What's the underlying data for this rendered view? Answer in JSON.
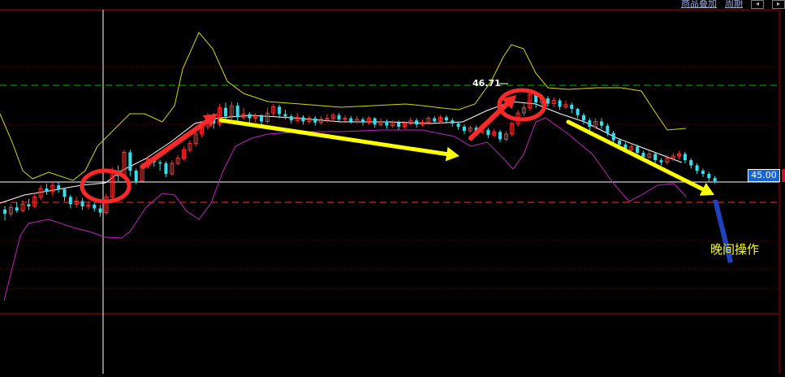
{
  "toolbar": {
    "overlay_label": "商品叠加",
    "period_label": "周期"
  },
  "price_tag": "45.00",
  "peak_label": "46.71",
  "annotation_text": "晚间操作",
  "colors": {
    "bg": "#000000",
    "frame": "#b00000",
    "up": "#ff3232",
    "down": "#34e0f0",
    "upper_band": "#d8d800",
    "lower_band": "#c020c0",
    "mid_band": "#ffffff",
    "green_dashed": "#00c000",
    "red_dashed": "#ff3030",
    "circle": "#ff2828",
    "arrow_yellow": "#ffff00",
    "arrow_blue": "#2040c0"
  },
  "chart_data": {
    "type": "candlestick",
    "y_reference": {
      "current_price": 45.0,
      "high_marker": 46.71
    },
    "overlays": [
      "bollinger-upper",
      "bollinger-mid",
      "bollinger-lower"
    ],
    "annotations": [
      "circle-1",
      "circle-2",
      "arrow-up-1",
      "arrow-down-1",
      "arrow-up-2",
      "arrow-down-2"
    ],
    "candles": [
      {
        "o": 44.46,
        "c": 44.38,
        "h": 44.52,
        "l": 44.25
      },
      {
        "o": 44.38,
        "c": 44.5,
        "h": 44.56,
        "l": 44.32
      },
      {
        "o": 44.5,
        "c": 44.44,
        "h": 44.6,
        "l": 44.4
      },
      {
        "o": 44.44,
        "c": 44.56,
        "h": 44.64,
        "l": 44.4
      },
      {
        "o": 44.56,
        "c": 44.52,
        "h": 44.66,
        "l": 44.45
      },
      {
        "o": 44.52,
        "c": 44.7,
        "h": 44.78,
        "l": 44.48
      },
      {
        "o": 44.7,
        "c": 44.86,
        "h": 44.92,
        "l": 44.64
      },
      {
        "o": 44.86,
        "c": 44.8,
        "h": 44.95,
        "l": 44.74
      },
      {
        "o": 44.8,
        "c": 44.92,
        "h": 45.0,
        "l": 44.72
      },
      {
        "o": 44.92,
        "c": 44.85,
        "h": 44.98,
        "l": 44.78
      },
      {
        "o": 44.85,
        "c": 44.7,
        "h": 44.88,
        "l": 44.62
      },
      {
        "o": 44.7,
        "c": 44.56,
        "h": 44.74,
        "l": 44.48
      },
      {
        "o": 44.56,
        "c": 44.62,
        "h": 44.7,
        "l": 44.5
      },
      {
        "o": 44.62,
        "c": 44.52,
        "h": 44.68,
        "l": 44.45
      },
      {
        "o": 44.52,
        "c": 44.55,
        "h": 44.62,
        "l": 44.46
      },
      {
        "o": 44.55,
        "c": 44.48,
        "h": 44.6,
        "l": 44.42
      },
      {
        "o": 44.48,
        "c": 44.4,
        "h": 44.55,
        "l": 44.32
      },
      {
        "o": 44.4,
        "c": 44.7,
        "h": 44.76,
        "l": 44.36
      },
      {
        "o": 44.7,
        "c": 45.2,
        "h": 45.26,
        "l": 44.66
      },
      {
        "o": 45.2,
        "c": 45.1,
        "h": 45.3,
        "l": 45.0
      },
      {
        "o": 45.1,
        "c": 45.55,
        "h": 45.6,
        "l": 45.05
      },
      {
        "o": 45.55,
        "c": 45.2,
        "h": 45.6,
        "l": 45.1
      },
      {
        "o": 45.2,
        "c": 45.0,
        "h": 45.24,
        "l": 44.94
      },
      {
        "o": 45.0,
        "c": 45.3,
        "h": 45.35,
        "l": 44.98
      },
      {
        "o": 45.3,
        "c": 45.42,
        "h": 45.5,
        "l": 45.24
      },
      {
        "o": 45.42,
        "c": 45.36,
        "h": 45.48,
        "l": 45.28
      },
      {
        "o": 45.36,
        "c": 45.34,
        "h": 45.4,
        "l": 45.2
      },
      {
        "o": 45.34,
        "c": 45.14,
        "h": 45.38,
        "l": 45.08
      },
      {
        "o": 45.14,
        "c": 45.34,
        "h": 45.4,
        "l": 45.1
      },
      {
        "o": 45.34,
        "c": 45.44,
        "h": 45.5,
        "l": 45.3
      },
      {
        "o": 45.44,
        "c": 45.6,
        "h": 45.66,
        "l": 45.4
      },
      {
        "o": 45.6,
        "c": 45.72,
        "h": 45.78,
        "l": 45.55
      },
      {
        "o": 45.72,
        "c": 45.9,
        "h": 45.96,
        "l": 45.66
      },
      {
        "o": 45.9,
        "c": 46.04,
        "h": 46.1,
        "l": 45.84
      },
      {
        "o": 46.04,
        "c": 46.22,
        "h": 46.3,
        "l": 45.98
      },
      {
        "o": 46.22,
        "c": 46.1,
        "h": 46.3,
        "l": 46.0
      },
      {
        "o": 46.1,
        "c": 46.4,
        "h": 46.48,
        "l": 46.04
      },
      {
        "o": 46.4,
        "c": 46.24,
        "h": 46.5,
        "l": 46.16
      },
      {
        "o": 46.24,
        "c": 46.44,
        "h": 46.52,
        "l": 46.18
      },
      {
        "o": 46.44,
        "c": 46.22,
        "h": 46.5,
        "l": 46.14
      },
      {
        "o": 46.22,
        "c": 46.28,
        "h": 46.4,
        "l": 46.18
      },
      {
        "o": 46.28,
        "c": 46.2,
        "h": 46.32,
        "l": 46.1
      },
      {
        "o": 46.2,
        "c": 46.24,
        "h": 46.3,
        "l": 46.12
      },
      {
        "o": 46.24,
        "c": 46.14,
        "h": 46.28,
        "l": 46.08
      },
      {
        "o": 46.14,
        "c": 46.3,
        "h": 46.4,
        "l": 46.1
      },
      {
        "o": 46.3,
        "c": 46.42,
        "h": 46.48,
        "l": 46.24
      },
      {
        "o": 46.42,
        "c": 46.28,
        "h": 46.46,
        "l": 46.2
      },
      {
        "o": 46.28,
        "c": 46.24,
        "h": 46.36,
        "l": 46.18
      },
      {
        "o": 46.24,
        "c": 46.16,
        "h": 46.28,
        "l": 46.1
      },
      {
        "o": 46.16,
        "c": 46.22,
        "h": 46.3,
        "l": 46.12
      },
      {
        "o": 46.22,
        "c": 46.14,
        "h": 46.26,
        "l": 46.08
      },
      {
        "o": 46.14,
        "c": 46.2,
        "h": 46.26,
        "l": 46.1
      },
      {
        "o": 46.2,
        "c": 46.12,
        "h": 46.24,
        "l": 46.06
      },
      {
        "o": 46.12,
        "c": 46.18,
        "h": 46.24,
        "l": 46.08
      },
      {
        "o": 46.18,
        "c": 46.2,
        "h": 46.28,
        "l": 46.12
      },
      {
        "o": 46.2,
        "c": 46.26,
        "h": 46.3,
        "l": 46.14
      },
      {
        "o": 46.26,
        "c": 46.18,
        "h": 46.3,
        "l": 46.12
      },
      {
        "o": 46.18,
        "c": 46.2,
        "h": 46.26,
        "l": 46.14
      },
      {
        "o": 46.2,
        "c": 46.14,
        "h": 46.24,
        "l": 46.1
      },
      {
        "o": 46.14,
        "c": 46.18,
        "h": 46.24,
        "l": 46.1
      },
      {
        "o": 46.18,
        "c": 46.12,
        "h": 46.22,
        "l": 46.06
      },
      {
        "o": 46.12,
        "c": 46.2,
        "h": 46.24,
        "l": 46.08
      },
      {
        "o": 46.2,
        "c": 46.08,
        "h": 46.22,
        "l": 46.02
      },
      {
        "o": 46.08,
        "c": 46.14,
        "h": 46.2,
        "l": 46.04
      },
      {
        "o": 46.14,
        "c": 46.06,
        "h": 46.18,
        "l": 46.0
      },
      {
        "o": 46.06,
        "c": 46.12,
        "h": 46.16,
        "l": 46.02
      },
      {
        "o": 46.12,
        "c": 46.04,
        "h": 46.16,
        "l": 45.98
      },
      {
        "o": 46.04,
        "c": 46.1,
        "h": 46.14,
        "l": 46.0
      },
      {
        "o": 46.1,
        "c": 46.16,
        "h": 46.22,
        "l": 46.06
      },
      {
        "o": 46.16,
        "c": 46.08,
        "h": 46.2,
        "l": 46.02
      },
      {
        "o": 46.08,
        "c": 46.12,
        "h": 46.18,
        "l": 46.04
      },
      {
        "o": 46.12,
        "c": 46.2,
        "h": 46.24,
        "l": 46.08
      },
      {
        "o": 46.2,
        "c": 46.14,
        "h": 46.24,
        "l": 46.1
      },
      {
        "o": 46.14,
        "c": 46.22,
        "h": 46.26,
        "l": 46.1
      },
      {
        "o": 46.22,
        "c": 46.16,
        "h": 46.26,
        "l": 46.1
      },
      {
        "o": 46.16,
        "c": 46.1,
        "h": 46.2,
        "l": 46.04
      },
      {
        "o": 46.1,
        "c": 46.04,
        "h": 46.14,
        "l": 45.98
      },
      {
        "o": 46.04,
        "c": 45.96,
        "h": 46.08,
        "l": 45.9
      },
      {
        "o": 45.96,
        "c": 46.02,
        "h": 46.06,
        "l": 45.92
      },
      {
        "o": 46.02,
        "c": 45.94,
        "h": 46.06,
        "l": 45.88
      },
      {
        "o": 45.94,
        "c": 45.98,
        "h": 46.02,
        "l": 45.9
      },
      {
        "o": 45.98,
        "c": 45.88,
        "h": 46.02,
        "l": 45.82
      },
      {
        "o": 45.88,
        "c": 45.94,
        "h": 46.0,
        "l": 45.84
      },
      {
        "o": 45.94,
        "c": 45.8,
        "h": 45.98,
        "l": 45.74
      },
      {
        "o": 45.8,
        "c": 45.9,
        "h": 45.96,
        "l": 45.76
      },
      {
        "o": 45.9,
        "c": 46.1,
        "h": 46.14,
        "l": 45.86
      },
      {
        "o": 46.1,
        "c": 46.3,
        "h": 46.36,
        "l": 46.04
      },
      {
        "o": 46.3,
        "c": 46.4,
        "h": 46.48,
        "l": 46.24
      },
      {
        "o": 46.4,
        "c": 46.66,
        "h": 46.71,
        "l": 46.34
      },
      {
        "o": 46.66,
        "c": 46.5,
        "h": 46.7,
        "l": 46.4
      },
      {
        "o": 46.5,
        "c": 46.58,
        "h": 46.66,
        "l": 46.44
      },
      {
        "o": 46.58,
        "c": 46.48,
        "h": 46.62,
        "l": 46.42
      },
      {
        "o": 46.48,
        "c": 46.54,
        "h": 46.6,
        "l": 46.42
      },
      {
        "o": 46.54,
        "c": 46.42,
        "h": 46.58,
        "l": 46.36
      },
      {
        "o": 46.42,
        "c": 46.46,
        "h": 46.54,
        "l": 46.38
      },
      {
        "o": 46.46,
        "c": 46.38,
        "h": 46.5,
        "l": 46.3
      },
      {
        "o": 46.38,
        "c": 46.26,
        "h": 46.4,
        "l": 46.2
      },
      {
        "o": 46.26,
        "c": 46.16,
        "h": 46.3,
        "l": 46.08
      },
      {
        "o": 46.16,
        "c": 46.04,
        "h": 46.2,
        "l": 45.96
      },
      {
        "o": 46.04,
        "c": 46.14,
        "h": 46.2,
        "l": 46.0
      },
      {
        "o": 46.14,
        "c": 46.06,
        "h": 46.2,
        "l": 46.0
      },
      {
        "o": 46.06,
        "c": 45.92,
        "h": 46.1,
        "l": 45.86
      },
      {
        "o": 45.92,
        "c": 45.78,
        "h": 45.96,
        "l": 45.72
      },
      {
        "o": 45.78,
        "c": 45.7,
        "h": 45.82,
        "l": 45.64
      },
      {
        "o": 45.7,
        "c": 45.6,
        "h": 45.74,
        "l": 45.54
      },
      {
        "o": 45.6,
        "c": 45.66,
        "h": 45.72,
        "l": 45.56
      },
      {
        "o": 45.66,
        "c": 45.54,
        "h": 45.7,
        "l": 45.48
      },
      {
        "o": 45.54,
        "c": 45.46,
        "h": 45.58,
        "l": 45.4
      },
      {
        "o": 45.46,
        "c": 45.52,
        "h": 45.58,
        "l": 45.42
      },
      {
        "o": 45.52,
        "c": 45.4,
        "h": 45.56,
        "l": 45.34
      },
      {
        "o": 45.4,
        "c": 45.36,
        "h": 45.44,
        "l": 45.3
      },
      {
        "o": 45.36,
        "c": 45.44,
        "h": 45.5,
        "l": 45.32
      },
      {
        "o": 45.44,
        "c": 45.48,
        "h": 45.54,
        "l": 45.38
      },
      {
        "o": 45.48,
        "c": 45.52,
        "h": 45.58,
        "l": 45.42
      },
      {
        "o": 45.52,
        "c": 45.4,
        "h": 45.56,
        "l": 45.34
      },
      {
        "o": 45.4,
        "c": 45.3,
        "h": 45.44,
        "l": 45.24
      },
      {
        "o": 45.3,
        "c": 45.2,
        "h": 45.34,
        "l": 45.14
      },
      {
        "o": 45.2,
        "c": 45.14,
        "h": 45.24,
        "l": 45.08
      },
      {
        "o": 45.14,
        "c": 45.06,
        "h": 45.18,
        "l": 45.0
      },
      {
        "o": 45.06,
        "c": 45.0,
        "h": 45.1,
        "l": 44.96
      }
    ]
  }
}
